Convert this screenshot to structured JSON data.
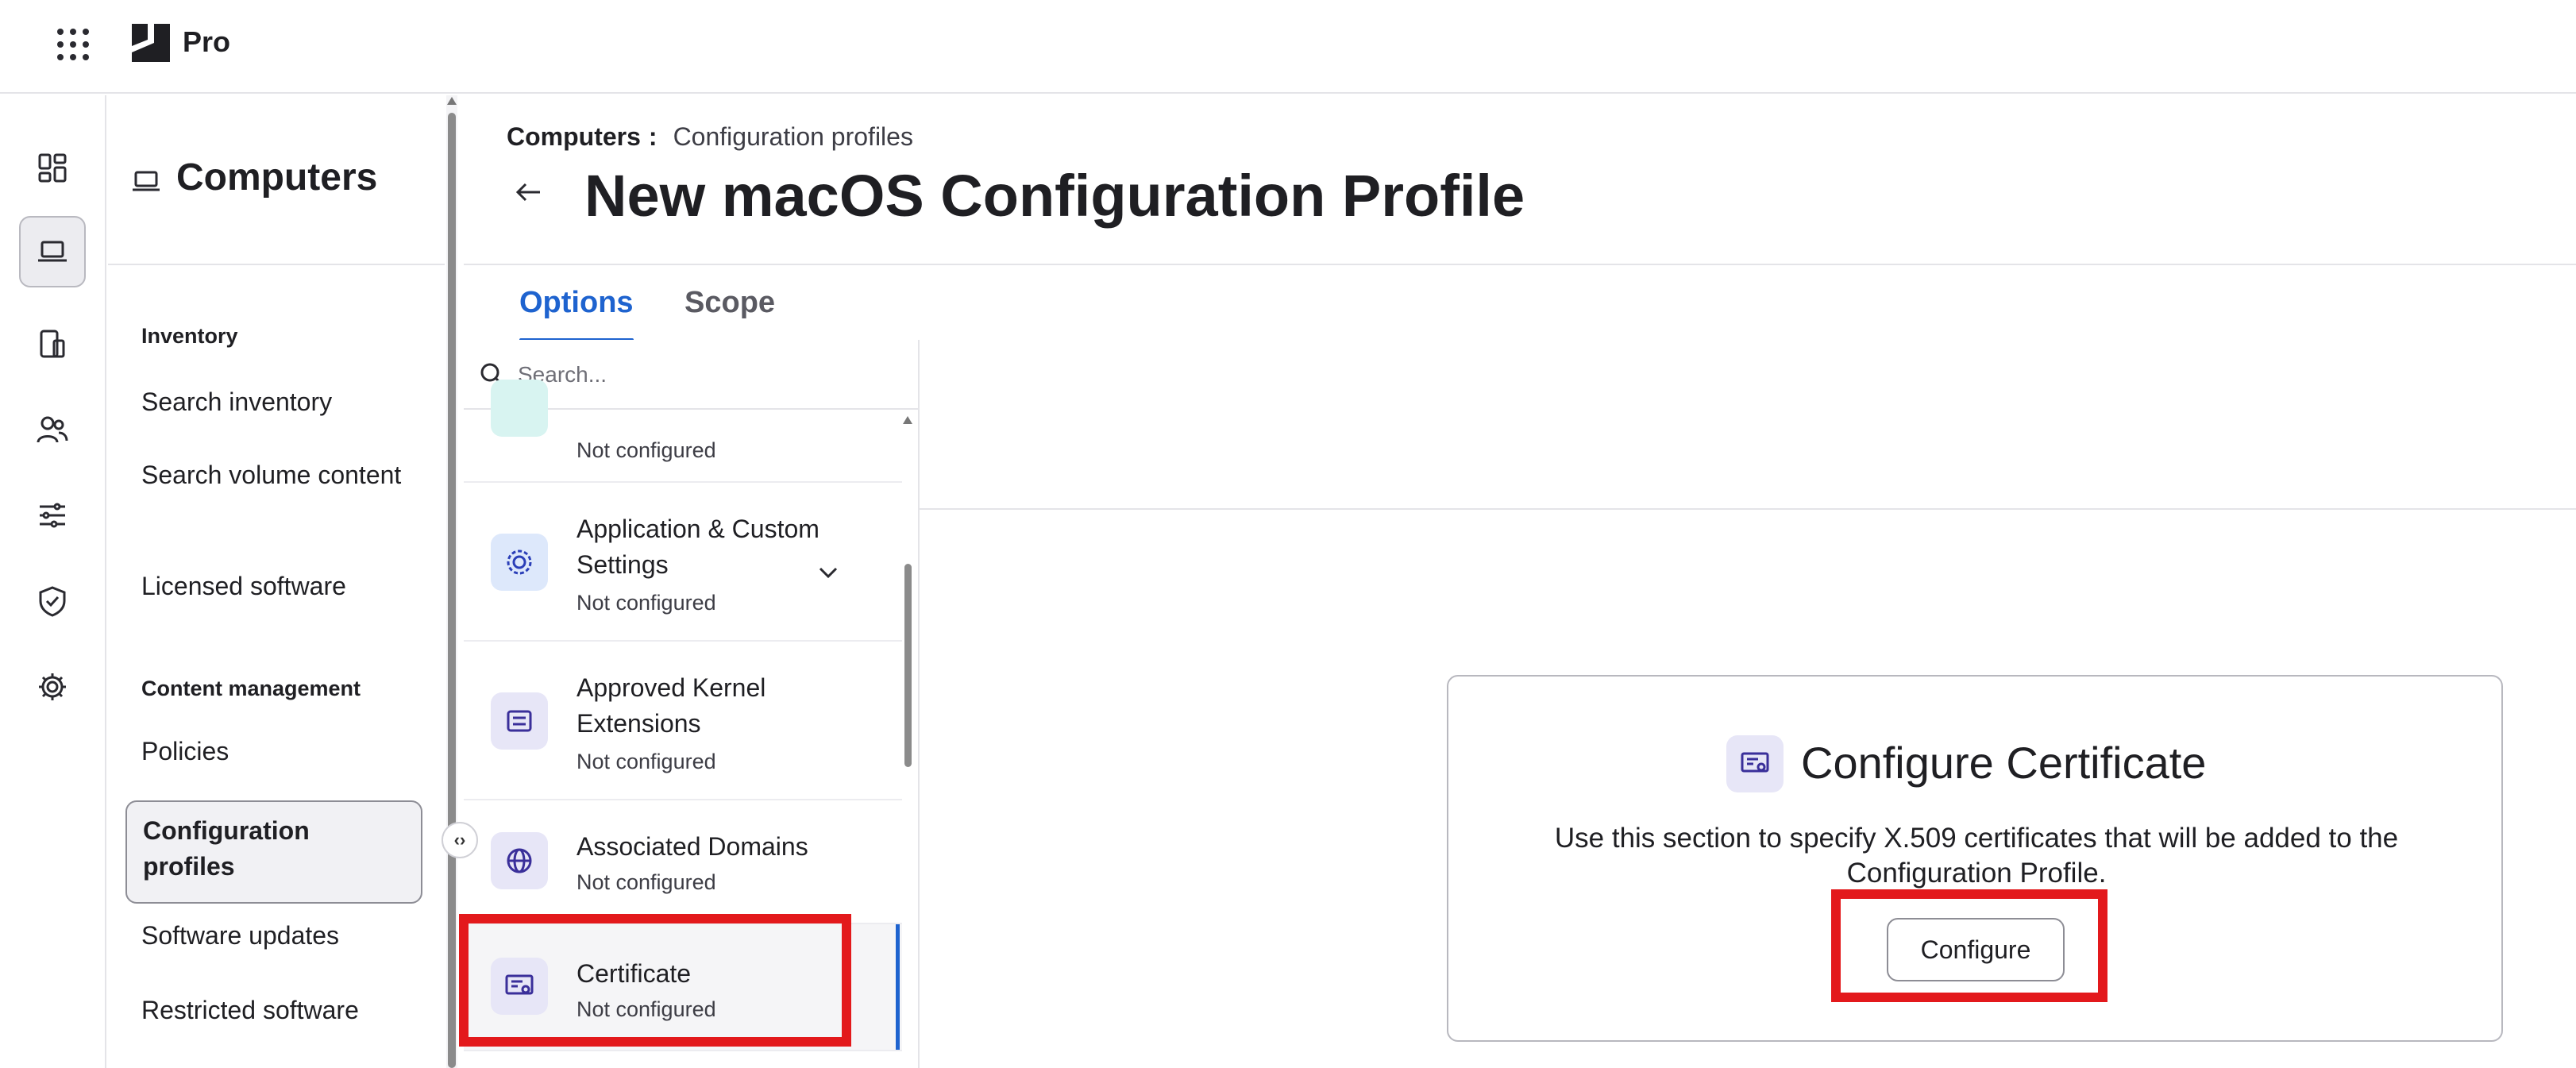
{
  "app": {
    "brand": "Pro"
  },
  "rail": [
    "dashboard-icon",
    "laptop-icon",
    "mobile-devices-icon",
    "users-icon",
    "settings-sliders-icon",
    "shield-icon",
    "gear-icon"
  ],
  "leftnav": {
    "title": "Computers",
    "sections": [
      {
        "label": "Inventory",
        "items": [
          "Search inventory",
          "Search volume content",
          "Licensed software"
        ]
      },
      {
        "label": "Content management",
        "items": [
          "Policies",
          "Configuration profiles",
          "Software updates",
          "Restricted software"
        ]
      }
    ]
  },
  "breadcrumb": {
    "root": "Computers",
    "separator": ":",
    "current": "Configuration profiles"
  },
  "page": {
    "title": "New macOS Configuration Profile"
  },
  "tabs": {
    "options": "Options",
    "scope": "Scope"
  },
  "search": {
    "placeholder": "Search..."
  },
  "payloads": [
    {
      "name": "",
      "status": "Not configured"
    },
    {
      "name": "Application & Custom Settings",
      "status": "Not configured"
    },
    {
      "name": "Approved Kernel Extensions",
      "status": "Not configured"
    },
    {
      "name": "Associated Domains",
      "status": "Not configured"
    },
    {
      "name": "Certificate",
      "status": "Not configured"
    }
  ],
  "card": {
    "title": "Configure Certificate",
    "description": "Use this section to specify X.509 certificates that will be added to the Configuration Profile.",
    "button": "Configure"
  },
  "colors": {
    "accent": "#1e63cf",
    "highlight": "#e3191c",
    "icon_bg": "#e7e6f7"
  }
}
